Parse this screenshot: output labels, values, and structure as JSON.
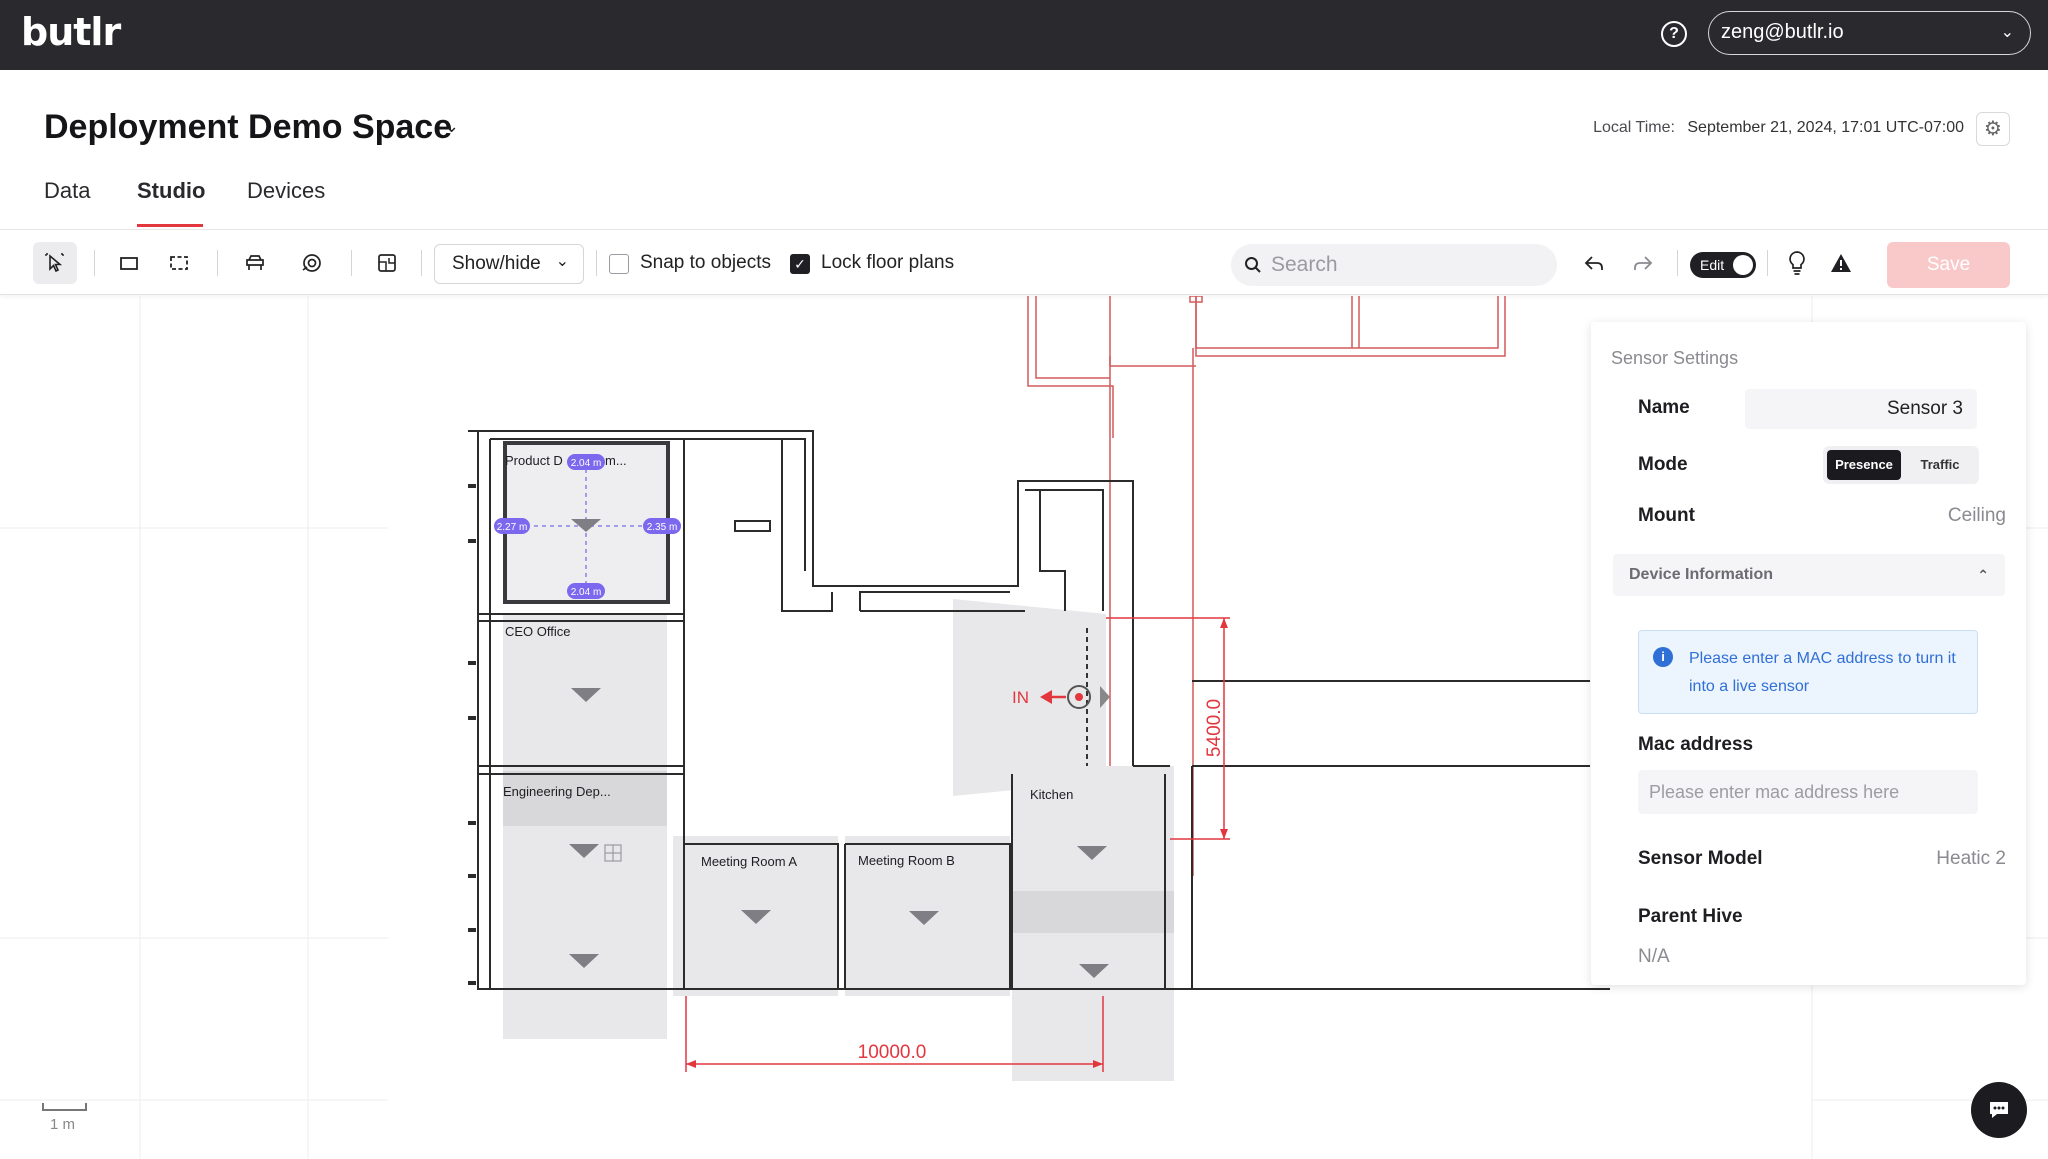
{
  "app": {
    "logo": "butlr",
    "user_email": "zeng@butlr.io",
    "help_icon": "help-circle-icon"
  },
  "header": {
    "space_title": "Deployment Demo Space",
    "local_time_label": "Local Time:",
    "local_time_value": "September 21, 2024, 17:01 UTC-07:00"
  },
  "tabs": [
    {
      "label": "Data",
      "active": false
    },
    {
      "label": "Studio",
      "active": true
    },
    {
      "label": "Devices",
      "active": false
    }
  ],
  "toolbar": {
    "showhide_label": "Show/hide",
    "snap_label": "Snap to objects",
    "snap_checked": false,
    "lock_label": "Lock floor plans",
    "lock_checked": true,
    "search_placeholder": "Search",
    "edit_label": "Edit",
    "save_label": "Save"
  },
  "floorplan": {
    "rooms": [
      {
        "label": "Product D"
      },
      {
        "label": "m..."
      },
      {
        "label": "CEO Office"
      },
      {
        "label": "Engineering Dep..."
      },
      {
        "label": "Meeting Room A"
      },
      {
        "label": "Meeting Room B"
      },
      {
        "label": "Kitchen"
      }
    ],
    "measurements": {
      "top": "2.04 m",
      "bottom": "2.04 m",
      "left": "2.27 m",
      "right": "2.35 m"
    },
    "dimension_horizontal": "10000.0",
    "dimension_vertical": "5400.0",
    "direction_label": "IN",
    "scale_label": "1 m"
  },
  "sensor_panel": {
    "title": "Sensor Settings",
    "name_label": "Name",
    "name_value": "Sensor 3",
    "mode_label": "Mode",
    "mode_options": [
      "Presence",
      "Traffic"
    ],
    "mode_selected": "Presence",
    "mount_label": "Mount",
    "mount_value": "Ceiling",
    "device_info_label": "Device Information",
    "info_message": "Please enter a MAC address to turn it into a live sensor",
    "mac_label": "Mac address",
    "mac_placeholder": "Please enter mac address here",
    "model_label": "Sensor Model",
    "model_value": "Heatic 2",
    "parent_label": "Parent Hive",
    "parent_value": "N/A"
  },
  "colors": {
    "topbar": "#2a2a2e",
    "accent_red": "#e2373f",
    "save_disabled": "#f9c9c9",
    "info_blue": "#2f6fd6",
    "measure_purple": "#7b68ee"
  }
}
